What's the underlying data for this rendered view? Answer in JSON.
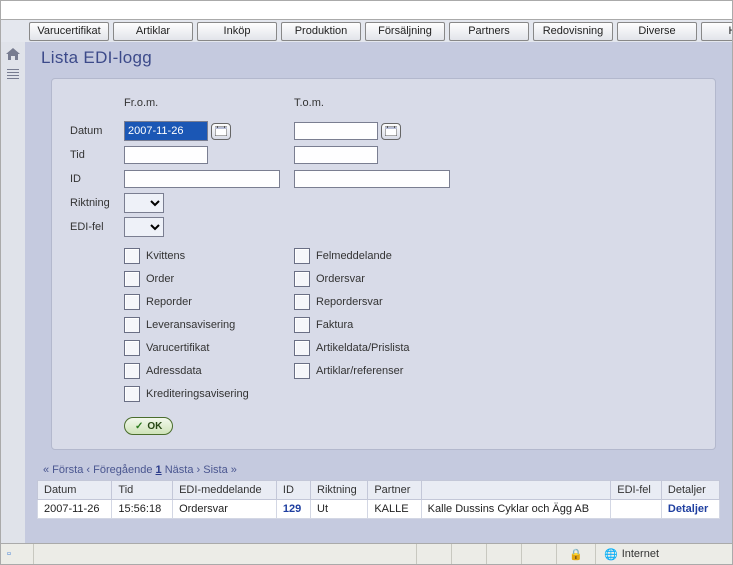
{
  "menu": {
    "items": [
      {
        "label": "Varucertifikat"
      },
      {
        "label": "Artiklar"
      },
      {
        "label": "Inköp"
      },
      {
        "label": "Produktion"
      },
      {
        "label": "Försäljning"
      },
      {
        "label": "Partners"
      },
      {
        "label": "Redovisning"
      },
      {
        "label": "Diverse"
      },
      {
        "label": "Hjälp"
      }
    ]
  },
  "page": {
    "title": "Lista EDI-logg"
  },
  "filter": {
    "from_header": "Fr.o.m.",
    "to_header": "T.o.m.",
    "labels": {
      "datum": "Datum",
      "tid": "Tid",
      "id": "ID",
      "riktning": "Riktning",
      "edifel": "EDI-fel"
    },
    "values": {
      "datum_from": "2007-11-26",
      "datum_to": "",
      "tid_from": "",
      "tid_to": "",
      "id_from": "",
      "id_to": "",
      "riktning": "",
      "edifel": ""
    },
    "checks_col1": [
      {
        "label": "Kvittens"
      },
      {
        "label": "Order"
      },
      {
        "label": "Reporder"
      },
      {
        "label": "Leveransavisering"
      },
      {
        "label": "Varucertifikat"
      },
      {
        "label": "Adressdata"
      },
      {
        "label": "Krediteringsavisering"
      }
    ],
    "checks_col2": [
      {
        "label": "Felmeddelande"
      },
      {
        "label": "Ordersvar"
      },
      {
        "label": "Repordersvar"
      },
      {
        "label": "Faktura"
      },
      {
        "label": "Artikeldata/Prislista"
      },
      {
        "label": "Artiklar/referenser"
      }
    ],
    "ok_label": "OK"
  },
  "pager": {
    "first": "« Första",
    "prev": "‹ Föregående",
    "current": "1",
    "next": "Nästa ›",
    "last": "Sista »"
  },
  "table": {
    "headers": {
      "datum": "Datum",
      "tid": "Tid",
      "edimsg": "EDI-meddelande",
      "id": "ID",
      "riktning": "Riktning",
      "partner": "Partner",
      "partner_name": "",
      "edifel": "EDI-fel",
      "detaljer": "Detaljer"
    },
    "rows": [
      {
        "datum": "2007-11-26",
        "tid": "15:56:18",
        "edimsg": "Ordersvar",
        "id": "129",
        "riktning": "Ut",
        "partner": "KALLE",
        "partner_name": "Kalle Dussins Cyklar och Ägg AB",
        "edifel": "",
        "detaljer": "Detaljer"
      }
    ]
  },
  "status": {
    "zone": "Internet"
  }
}
